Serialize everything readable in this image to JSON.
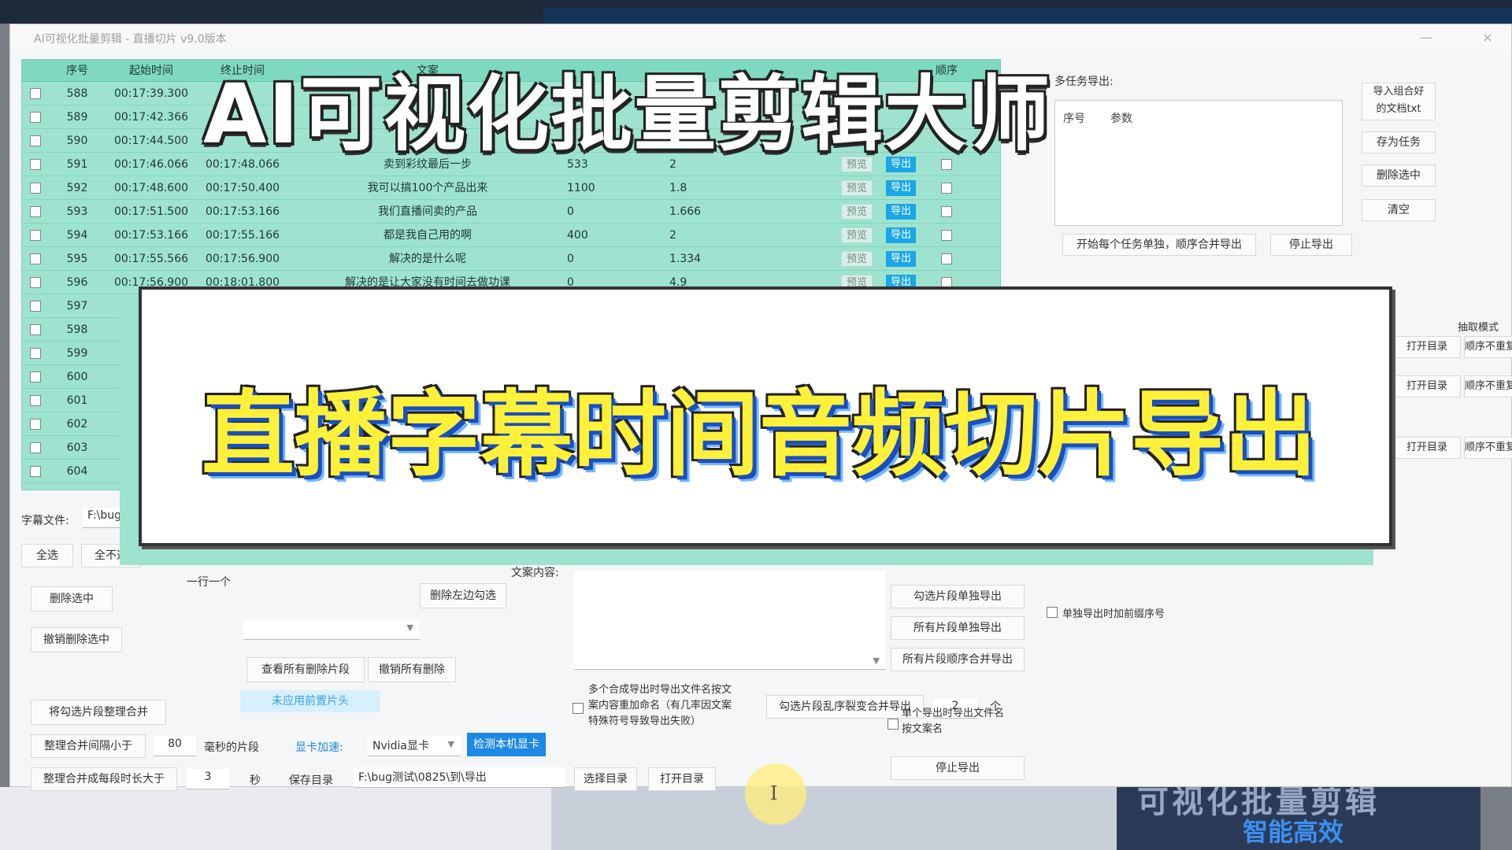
{
  "window": {
    "title": "AI可视化批量剪辑 - 直播切片 v9.0版本",
    "minimize": "—",
    "close": "×"
  },
  "table": {
    "headers": [
      "序号",
      "起始时间",
      "终止时间",
      "文案",
      "",
      "",
      "",
      "",
      "",
      "顺序"
    ],
    "rows": [
      {
        "no": "588",
        "start": "00:17:39.300",
        "end": "",
        "text": "",
        "a": "",
        "b": ""
      },
      {
        "no": "589",
        "start": "00:17:42.366",
        "end": "",
        "text": "",
        "a": "",
        "b": ""
      },
      {
        "no": "590",
        "start": "00:17:44.500",
        "end": "",
        "text": "",
        "a": "",
        "b": ""
      },
      {
        "no": "591",
        "start": "00:17:46.066",
        "end": "00:17:48.066",
        "text": "卖到彩纹最后一步",
        "a": "533",
        "b": "2"
      },
      {
        "no": "592",
        "start": "00:17:48.600",
        "end": "00:17:50.400",
        "text": "我可以搞100个产品出来",
        "a": "1100",
        "b": "1.8"
      },
      {
        "no": "593",
        "start": "00:17:51.500",
        "end": "00:17:53.166",
        "text": "我们直播间卖的产品",
        "a": "0",
        "b": "1.666"
      },
      {
        "no": "594",
        "start": "00:17:53.166",
        "end": "00:17:55.166",
        "text": "都是我自己用的啊",
        "a": "400",
        "b": "2"
      },
      {
        "no": "595",
        "start": "00:17:55.566",
        "end": "00:17:56.900",
        "text": "解决的是什么呢",
        "a": "0",
        "b": "1.334"
      },
      {
        "no": "596",
        "start": "00:17:56.900",
        "end": "00:18:01.800",
        "text": "解决的是让大家没有时间去做功课",
        "a": "0",
        "b": "4.9"
      },
      {
        "no": "597",
        "start": "",
        "end": "",
        "text": "",
        "a": "",
        "b": ""
      },
      {
        "no": "598",
        "start": "",
        "end": "",
        "text": "",
        "a": "",
        "b": ""
      },
      {
        "no": "599",
        "start": "",
        "end": "",
        "text": "",
        "a": "",
        "b": ""
      },
      {
        "no": "600",
        "start": "",
        "end": "",
        "text": "",
        "a": "",
        "b": ""
      },
      {
        "no": "601",
        "start": "",
        "end": "",
        "text": "",
        "a": "",
        "b": ""
      },
      {
        "no": "602",
        "start": "",
        "end": "",
        "text": "",
        "a": "",
        "b": ""
      },
      {
        "no": "603",
        "start": "",
        "end": "",
        "text": "",
        "a": "",
        "b": ""
      },
      {
        "no": "604",
        "start": "",
        "end": "",
        "text": "",
        "a": "",
        "b": ""
      }
    ],
    "preview_label": "预览",
    "export_label": "导出"
  },
  "multitask": {
    "label": "多任务导出:",
    "col_no": "序号",
    "col_params": "参数",
    "import_btn_line1": "导入组合好",
    "import_btn_line2": "的文档txt",
    "save_task": "存为任务",
    "delete_selected": "删除选中",
    "clear": "清空",
    "start_export": "开始每个任务单独，顺序合并导出",
    "stop_export": "停止导出",
    "extract_mode": "抽取模式",
    "open_dir": "打开目录",
    "order_no_repeat": "顺序不重复"
  },
  "bottom": {
    "subtitle_label": "字幕文件:",
    "subtitle_path": "F:\\bug",
    "select_all": "全选",
    "select_none": "全不选",
    "one_per_line": "一行一个",
    "delete_selected": "删除选中",
    "undo_delete": "撤销删除选中",
    "delete_left_checked": "删除左边勾选",
    "view_deleted": "查看所有删除片段",
    "undo_all_deleted": "撤销所有删除",
    "unapplied_head": "未应用前置片头",
    "merge_checked": "将勾选片段整理合并",
    "merge_gap_label": "整理合并间隔小于",
    "merge_gap_value": "80",
    "merge_gap_unit": "毫秒的片段",
    "merge_min_label": "整理合并成每段时长大于",
    "merge_min_value": "3",
    "merge_min_unit": "秒",
    "gpu_label": "显卡加速:",
    "gpu_value": "Nvidia显卡",
    "detect_gpu": "检测本机显卡",
    "save_dir_label": "保存目录",
    "save_dir_value": "F:\\bug测试\\0825\\到\\导出",
    "choose_dir": "选择目录",
    "open_dir": "打开目录",
    "content_label": "文案内容:",
    "rename_note_line1": "多个合成导出时导出文件名按文",
    "rename_note_line2": "案内容重加命名（有几率因文案",
    "rename_note_line3": "特殊符号导致导出失败）",
    "random_merge": "勾选片段乱序裂变合并导出",
    "random_count": "2",
    "random_unit": "个",
    "single_name_line1": "单个导出时导出文件名",
    "single_name_line2": "按文案名",
    "export_checked_single": "勾选片段单独导出",
    "export_all_single": "所有片段单独导出",
    "export_all_merge": "所有片段顺序合并导出",
    "stop_export": "停止导出",
    "add_prefix_no": "单独导出时加前缀序号"
  },
  "overlays": {
    "headline": "AI可视化批量剪辑大师",
    "subtitle": "直播字幕时间音频切片导出"
  },
  "banner": {
    "big": "可视化批量剪辑",
    "small": "智能高效"
  }
}
